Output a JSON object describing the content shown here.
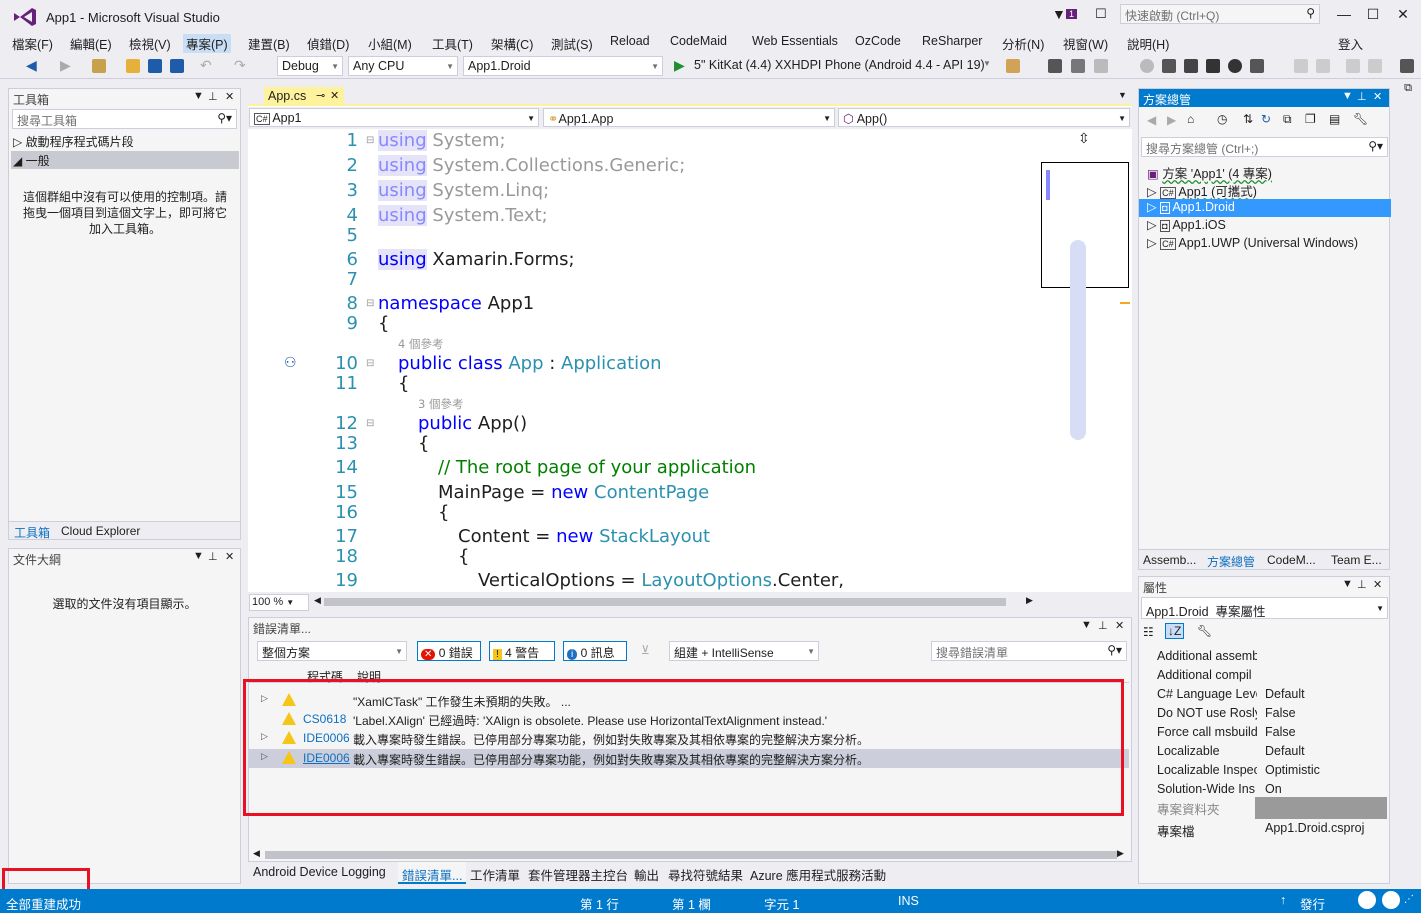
{
  "window": {
    "title": "App1 - Microsoft Visual Studio",
    "quick_launch_placeholder": "快速啟動 (Ctrl+Q)",
    "notify_count": "1"
  },
  "menu": [
    "檔案(F)",
    "編輯(E)",
    "檢視(V)",
    "專案(P)",
    "建置(B)",
    "偵錯(D)",
    "小組(M)",
    "工具(T)",
    "架構(C)",
    "測試(S)",
    "Reload",
    "CodeMaid",
    "Web Essentials",
    "OzCode",
    "ReSharper",
    "分析(N)",
    "視窗(W)",
    "說明(H)"
  ],
  "signin": "登入",
  "toolbar": {
    "config": "Debug",
    "platform": "Any CPU",
    "startup_project": "App1.Droid",
    "run_target": "5\" KitKat (4.4) XXHDPI Phone (Android 4.4 - API 19)"
  },
  "toolbox": {
    "title": "工具箱",
    "search_placeholder": "搜尋工具箱",
    "group1": "啟動程序程式碼片段",
    "group2": "一般",
    "empty_text": "這個群組中沒有可以使用的控制項。請拖曳一個項目到這個文字上，即可將它加入工具箱。",
    "tab1": "工具箱",
    "tab2": "Cloud Explorer"
  },
  "outline": {
    "title": "文件大綱",
    "empty_text": "選取的文件沒有項目顯示。"
  },
  "editor": {
    "tab": "App.cs",
    "nav": [
      "App1",
      "App1.App",
      "App()"
    ],
    "zoom": "100 %",
    "lines": [
      {
        "n": "1",
        "t": "using System;"
      },
      {
        "n": "2",
        "t": "using System.Collections.Generic;"
      },
      {
        "n": "3",
        "t": "using System.Linq;"
      },
      {
        "n": "4",
        "t": "using System.Text;"
      },
      {
        "n": "5",
        "t": ""
      },
      {
        "n": "6",
        "t": "using Xamarin.Forms;"
      },
      {
        "n": "7",
        "t": ""
      },
      {
        "n": "8",
        "t": "namespace App1"
      },
      {
        "n": "9",
        "t": "{"
      },
      {
        "n": "10",
        "t": "public class App : Application"
      },
      {
        "n": "11",
        "t": "{"
      },
      {
        "n": "12",
        "t": "public App()"
      },
      {
        "n": "13",
        "t": "{"
      },
      {
        "n": "14",
        "t": "// The root page of your application"
      },
      {
        "n": "15",
        "t": "MainPage = new ContentPage"
      },
      {
        "n": "16",
        "t": "{"
      },
      {
        "n": "17",
        "t": "Content = new StackLayout"
      },
      {
        "n": "18",
        "t": "{"
      },
      {
        "n": "19",
        "t": "VerticalOptions = LayoutOptions.Center,"
      }
    ],
    "refs1": "4 個參考",
    "refs2": "3 個參考"
  },
  "solution": {
    "title": "方案總管",
    "search_placeholder": "搜尋方案總管 (Ctrl+;)",
    "root": "方案 'App1' (4 專案)",
    "items": [
      "App1 (可攜式)",
      "App1.Droid",
      "App1.iOS",
      "App1.UWP (Universal Windows)"
    ],
    "tabs": [
      "Assemb...",
      "方案總管",
      "CodeM...",
      "Team E..."
    ]
  },
  "properties": {
    "title": "屬性",
    "object": "App1.Droid  專案屬性",
    "rows": [
      {
        "k": "Additional assemb",
        "v": ""
      },
      {
        "k": "Additional compil",
        "v": ""
      },
      {
        "k": "C# Language Leve",
        "v": "Default"
      },
      {
        "k": "Do NOT use Rosly",
        "v": "False"
      },
      {
        "k": "Force call msbuild",
        "v": "False"
      },
      {
        "k": "Localizable",
        "v": "Default"
      },
      {
        "k": "Localizable Inspec",
        "v": "Optimistic"
      },
      {
        "k": "Solution-Wide Ins",
        "v": "On"
      },
      {
        "k": "專案資料夾",
        "v": ""
      },
      {
        "k": "專案檔",
        "v": "App1.Droid.csproj"
      }
    ]
  },
  "errors": {
    "title": "錯誤清單...",
    "scope": "整個方案",
    "errors_btn": "0 錯誤",
    "warnings_btn": "4 警告",
    "messages_btn": "0 訊息",
    "build_filter": "組建 + IntelliSense",
    "search_placeholder": "搜尋錯誤清單",
    "col_code": "程式碼",
    "col_desc": "說明",
    "rows": [
      {
        "code": "",
        "desc": "\"XamlCTask\" 工作發生未預期的失敗。 ..."
      },
      {
        "code": "CS0618",
        "desc": "'Label.XAlign' 已經過時: 'XAlign is obsolete. Please use HorizontalTextAlignment instead.'"
      },
      {
        "code": "IDE0006",
        "desc": "載入專案時發生錯誤。已停用部分專案功能，例如對失敗專案及其相依專案的完整解決方案分析。"
      },
      {
        "code": "IDE0006",
        "desc": "載入專案時發生錯誤。已停用部分專案功能，例如對失敗專案及其相依專案的完整解決方案分析。"
      }
    ]
  },
  "bottom_tabs": [
    "Android Device Logging",
    "錯誤清單...",
    "工作清單",
    "套件管理器主控台",
    "輸出",
    "尋找符號結果",
    "Azure 應用程式服務活動"
  ],
  "status": {
    "message": "全部重建成功",
    "line": "第 1 行",
    "col": "第 1 欄",
    "char": "字元 1",
    "mode": "INS",
    "publish": "發行"
  },
  "colors": {
    "accent": "#007ACC",
    "highlight_box": "#E81123",
    "warning": "#F5C518",
    "selected": "#3399FF"
  }
}
